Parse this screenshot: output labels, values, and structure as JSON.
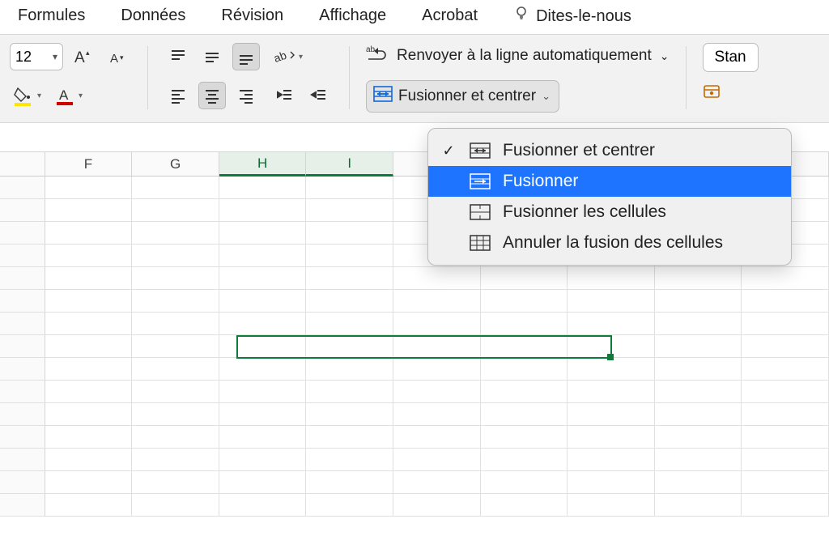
{
  "menubar": {
    "formulas": "Formules",
    "data": "Données",
    "review": "Révision",
    "view": "Affichage",
    "acrobat": "Acrobat",
    "tellme": "Dites-le-nous"
  },
  "ribbon": {
    "font_size": "12",
    "wrap_text_label": "Renvoyer à la ligne automatiquement",
    "merge_button_label": "Fusionner et centrer",
    "number_format_label": "Stan"
  },
  "merge_menu": {
    "merge_center": "Fusionner et centrer",
    "merge_across": "Fusionner",
    "merge_cells": "Fusionner les cellules",
    "unmerge": "Annuler la fusion des cellules"
  },
  "columns": [
    "F",
    "G",
    "H",
    "I",
    "",
    "",
    "",
    "",
    ""
  ],
  "selected_cols_start": 2,
  "selected_cols_end": 3
}
